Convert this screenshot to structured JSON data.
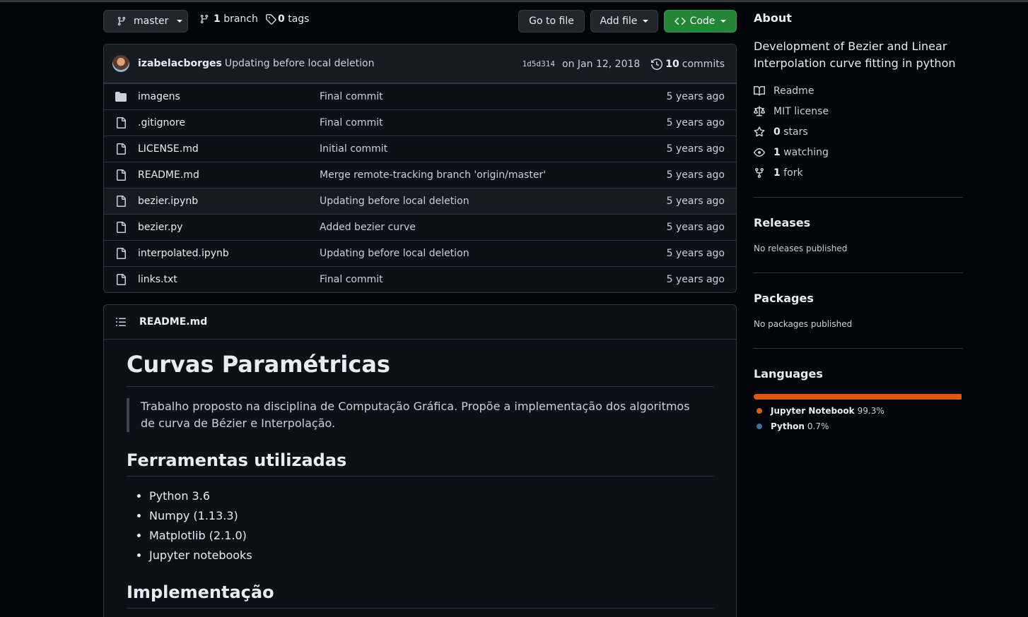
{
  "toolbar": {
    "branch_name": "master",
    "branch_count": "1",
    "branch_label": "branch",
    "tag_count": "0",
    "tag_label": "tags",
    "go_to_file": "Go to file",
    "add_file": "Add file",
    "code": "Code"
  },
  "commit": {
    "author": "izabelacborges",
    "message": "Updating before local deletion",
    "sha": "1d5d314",
    "date": "on Jan 12, 2018",
    "count": "10",
    "count_label": "commits"
  },
  "files": [
    {
      "name": "imagens",
      "type": "folder",
      "message": "Final commit",
      "age": "5 years ago"
    },
    {
      "name": ".gitignore",
      "type": "file",
      "message": "Final commit",
      "age": "5 years ago"
    },
    {
      "name": "LICENSE.md",
      "type": "file",
      "message": "Initial commit",
      "age": "5 years ago"
    },
    {
      "name": "README.md",
      "type": "file",
      "message": "Merge remote-tracking branch 'origin/master'",
      "age": "5 years ago"
    },
    {
      "name": "bezier.ipynb",
      "type": "file",
      "message": "Updating before local deletion",
      "age": "5 years ago"
    },
    {
      "name": "bezier.py",
      "type": "file",
      "message": "Added bezier curve",
      "age": "5 years ago"
    },
    {
      "name": "interpolated.ipynb",
      "type": "file",
      "message": "Updating before local deletion",
      "age": "5 years ago"
    },
    {
      "name": "links.txt",
      "type": "file",
      "message": "Final commit",
      "age": "5 years ago"
    }
  ],
  "readme": {
    "filename": "README.md",
    "h1": "Curvas Paramétricas",
    "quote": "Trabalho proposto na disciplina de Computação Gráfica. Propõe a implementação dos algoritmos de curva de Bézier e Interpolação.",
    "h2_tools": "Ferramentas utilizadas",
    "tools": [
      "Python 3.6",
      "Numpy (1.13.3)",
      "Matplotlib (2.1.0)",
      "Jupyter notebooks"
    ],
    "h2_impl": "Implementação"
  },
  "about": {
    "title": "About",
    "description": "Development of Bezier and Linear Interpolation curve fitting in python",
    "readme": "Readme",
    "license": "MIT license",
    "stars_count": "0",
    "stars_label": "stars",
    "watching_count": "1",
    "watching_label": "watching",
    "fork_count": "1",
    "fork_label": "fork"
  },
  "releases": {
    "title": "Releases",
    "text": "No releases published"
  },
  "packages": {
    "title": "Packages",
    "text": "No packages published"
  },
  "languages": {
    "title": "Languages",
    "items": [
      {
        "name": "Jupyter Notebook",
        "percent": "99.3%",
        "share": 99.3,
        "color": "#DA5B0B"
      },
      {
        "name": "Python",
        "percent": "0.7%",
        "share": 0.7,
        "color": "#3572A5"
      }
    ]
  }
}
